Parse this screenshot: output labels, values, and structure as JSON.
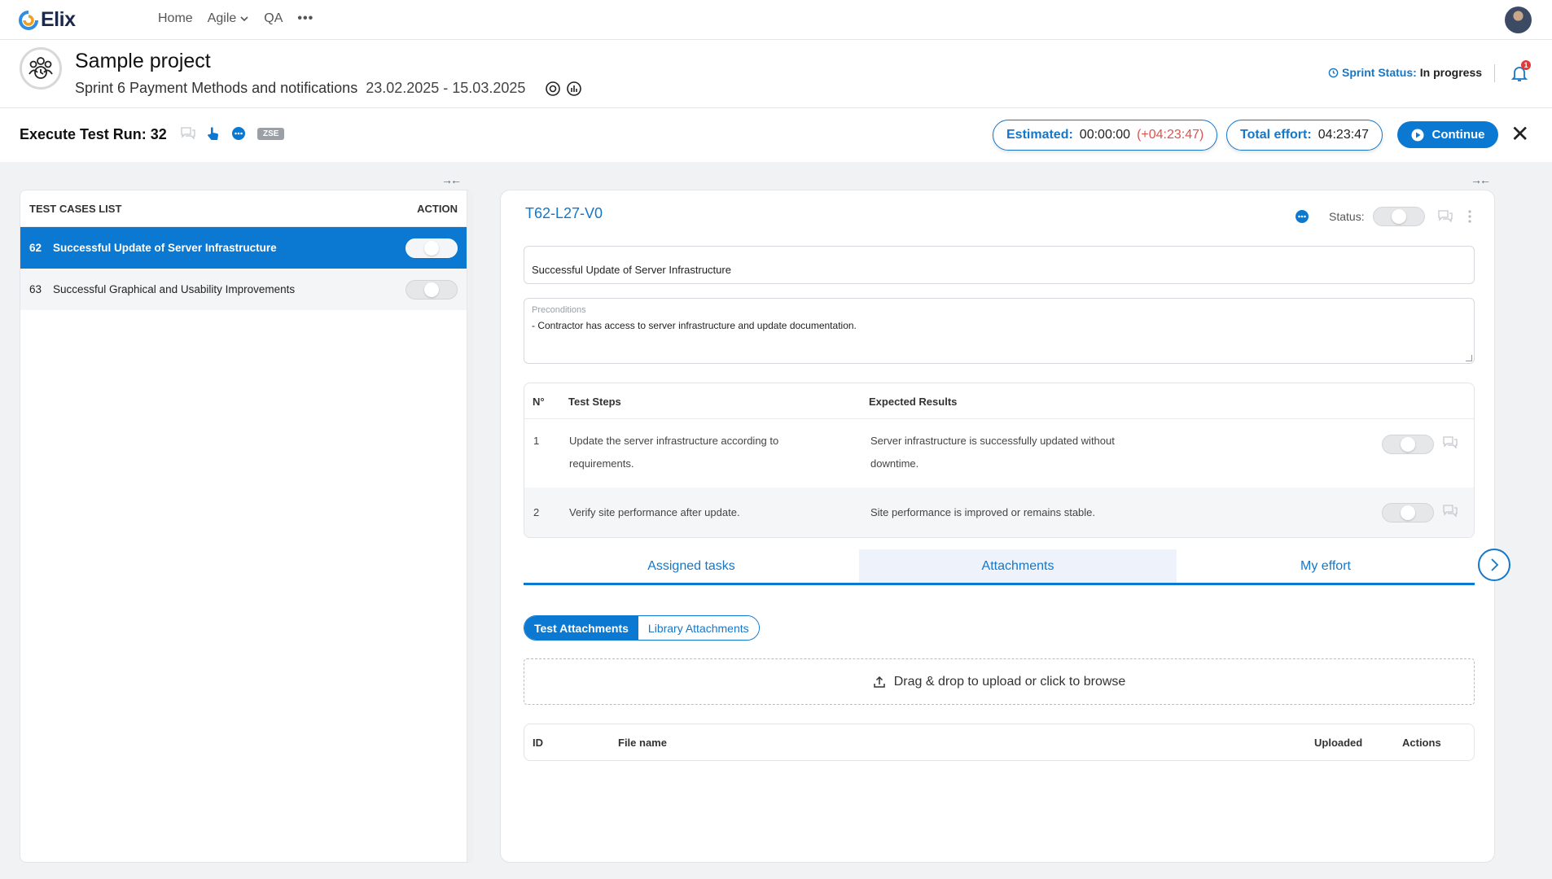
{
  "app": {
    "name": "Elix",
    "nav": [
      "Home",
      "Agile",
      "QA"
    ],
    "more": "•••"
  },
  "project": {
    "title": "Sample project",
    "sprint_name": "Sprint 6 Payment Methods and notifications",
    "sprint_dates": "23.02.2025 - 15.03.2025",
    "sprint_status_label": "Sprint Status:",
    "sprint_status_value": "In progress",
    "notifications_count": "1"
  },
  "run": {
    "title": "Execute Test Run: 32",
    "badge": "ZSE",
    "estimated_label": "Estimated:",
    "estimated_value": "00:00:00",
    "estimated_overrun": "(+04:23:47)",
    "effort_label": "Total effort:",
    "effort_value": "04:23:47",
    "continue_label": "Continue"
  },
  "test_cases": {
    "header_left": "TEST CASES LIST",
    "header_right": "ACTION",
    "items": [
      {
        "num": "62",
        "name": "Successful Update of Server Infrastructure"
      },
      {
        "num": "63",
        "name": "Successful Graphical and Usability Improvements"
      }
    ]
  },
  "detail": {
    "id": "T62-L27-V0",
    "status_label": "Status:",
    "title_value": "Successful Update of Server Infrastructure",
    "preconditions_label": "Preconditions",
    "preconditions_value": "- Contractor has access to server infrastructure and update documentation.",
    "steps_headers": {
      "num": "N°",
      "steps": "Test Steps",
      "expected": "Expected Results"
    },
    "steps": [
      {
        "num": "1",
        "step_line1": "Update the server infrastructure according to",
        "step_line2": "requirements.",
        "expected_line1": "Server infrastructure is successfully updated without",
        "expected_line2": "downtime."
      },
      {
        "num": "2",
        "step_line1": "Verify site performance after update.",
        "step_line2": "",
        "expected_line1": "Site performance is improved or remains stable.",
        "expected_line2": ""
      }
    ],
    "tabs": [
      "Assigned tasks",
      "Attachments",
      "My effort"
    ],
    "attachment_modes": [
      "Test Attachments",
      "Library Attachments"
    ],
    "dropzone_text": "Drag & drop to upload or click to browse",
    "attachments_headers": {
      "id": "ID",
      "file": "File name",
      "uploaded": "Uploaded",
      "actions": "Actions"
    }
  },
  "colors": {
    "primary": "#0b78d1",
    "accent_text": "#1677c8",
    "overrun": "#d9534f",
    "badge": "#e53935"
  }
}
